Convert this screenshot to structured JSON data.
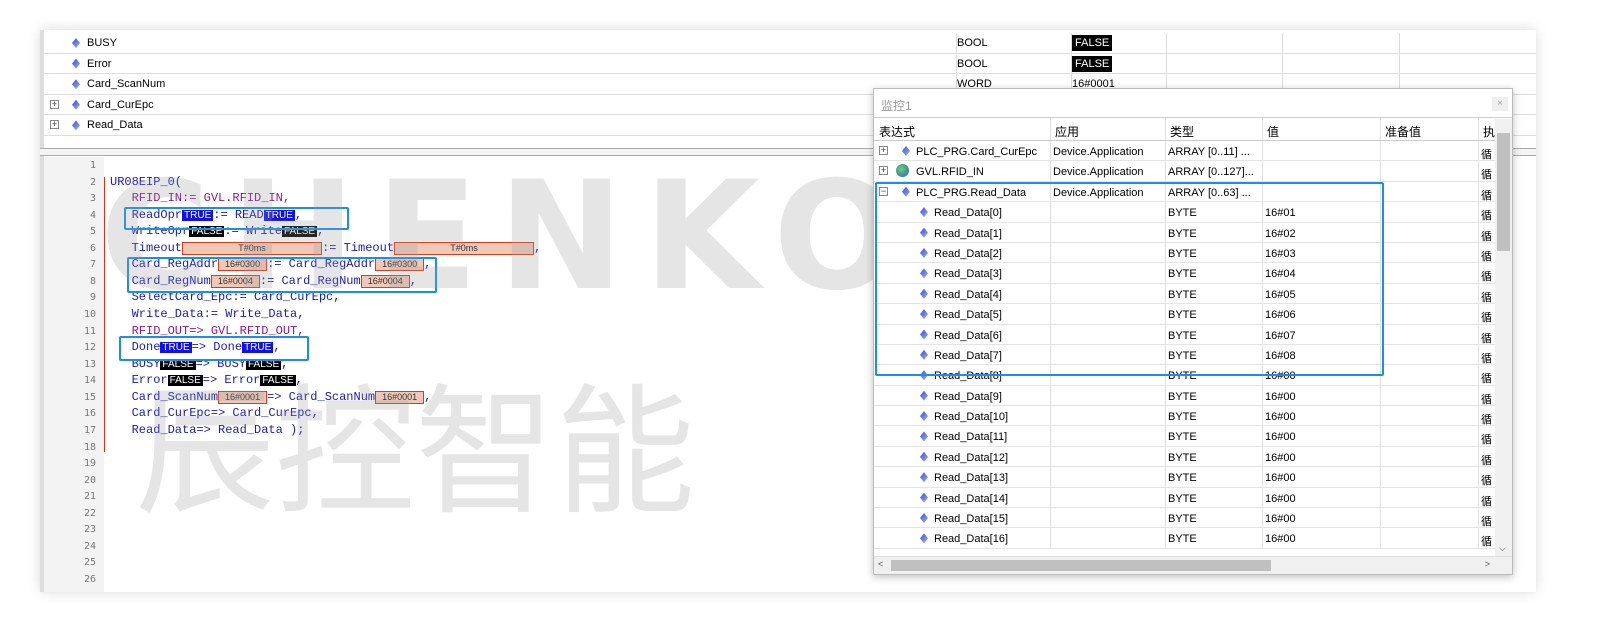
{
  "variables": [
    {
      "name": "BUSY",
      "type": "BOOL",
      "value": "FALSE",
      "expandable": false
    },
    {
      "name": "Error",
      "type": "BOOL",
      "value": "FALSE",
      "expandable": false
    },
    {
      "name": "Card_ScanNum",
      "type": "WORD",
      "value": "16#0001",
      "expandable": false
    },
    {
      "name": "Card_CurEpc",
      "type": "",
      "value": "",
      "expandable": true
    },
    {
      "name": "Read_Data",
      "type": "",
      "value": "",
      "expandable": true
    }
  ],
  "code": {
    "line_numbers": [
      "1",
      "2",
      "3",
      "4",
      "5",
      "6",
      "7",
      "8",
      "9",
      "10",
      "11",
      "12",
      "13",
      "14",
      "15",
      "16",
      "17",
      "18",
      "19",
      "20",
      "21",
      "22",
      "23",
      "24",
      "25",
      "26"
    ],
    "lines": [
      [],
      [
        {
          "t": "UR08EIP_0(",
          "c": "kw"
        }
      ],
      [
        {
          "t": "   RFID_IN:= GVL.RFID_IN,",
          "c": "purple"
        }
      ],
      [
        {
          "t": "   ReadOpr",
          "c": "kw"
        },
        {
          "t": "TRUE",
          "c": "tv"
        },
        {
          "t": ":= READ",
          "c": "kw"
        },
        {
          "t": "TRUE",
          "c": "tv"
        },
        {
          "t": ",",
          "c": "kw"
        }
      ],
      [
        {
          "t": "   WriteOpr",
          "c": "kw"
        },
        {
          "t": "FALSE",
          "c": "fv"
        },
        {
          "t": ":= Write",
          "c": "kw"
        },
        {
          "t": "FALSE",
          "c": "fv"
        },
        {
          "t": ",",
          "c": "kw"
        }
      ],
      [
        {
          "t": "   Timeout",
          "c": "kw"
        },
        {
          "t": "T#0ms",
          "c": "hv wide"
        },
        {
          "t": ":= Timeout",
          "c": "kw"
        },
        {
          "t": "T#0ms",
          "c": "hv wide"
        },
        {
          "t": ",",
          "c": "kw"
        }
      ],
      [
        {
          "t": "   Card_RegAddr",
          "c": "kw"
        },
        {
          "t": "16#0300",
          "c": "hv"
        },
        {
          "t": ":= Card_RegAddr",
          "c": "kw"
        },
        {
          "t": "16#0300",
          "c": "hv"
        },
        {
          "t": ",",
          "c": "kw"
        }
      ],
      [
        {
          "t": "   Card_RegNum",
          "c": "kw"
        },
        {
          "t": "16#0004",
          "c": "hv"
        },
        {
          "t": ":= Card_RegNum",
          "c": "kw"
        },
        {
          "t": "16#0004",
          "c": "hv"
        },
        {
          "t": ",",
          "c": "kw"
        }
      ],
      [
        {
          "t": "   SelectCard_Epc:= Card_CurEpc,",
          "c": "kw"
        }
      ],
      [
        {
          "t": "   Write_Data:= Write_Data,",
          "c": "kw"
        }
      ],
      [
        {
          "t": "   RFID_OUT=> GVL.RFID_OUT,",
          "c": "purple"
        }
      ],
      [
        {
          "t": "   Done",
          "c": "kw"
        },
        {
          "t": "TRUE",
          "c": "tv"
        },
        {
          "t": "=> Done",
          "c": "kw"
        },
        {
          "t": "TRUE",
          "c": "tv"
        },
        {
          "t": ",",
          "c": "kw"
        }
      ],
      [
        {
          "t": "   BUSY",
          "c": "kw"
        },
        {
          "t": "FALSE",
          "c": "fv"
        },
        {
          "t": "=> BUSY",
          "c": "kw"
        },
        {
          "t": "FALSE",
          "c": "fv"
        },
        {
          "t": ",",
          "c": "kw"
        }
      ],
      [
        {
          "t": "   Error",
          "c": "kw"
        },
        {
          "t": "FALSE",
          "c": "fv"
        },
        {
          "t": "=> Error",
          "c": "kw"
        },
        {
          "t": "FALSE",
          "c": "fv"
        },
        {
          "t": ",",
          "c": "kw"
        }
      ],
      [
        {
          "t": "   Card_ScanNum",
          "c": "kw"
        },
        {
          "t": "16#0001",
          "c": "hv"
        },
        {
          "t": "=> Card_ScanNum",
          "c": "kw"
        },
        {
          "t": "16#0001",
          "c": "hv"
        },
        {
          "t": ",",
          "c": "kw"
        }
      ],
      [
        {
          "t": "   Card_CurEpc=> Card_CurEpc,",
          "c": "kw"
        }
      ],
      [
        {
          "t": "   Read_Data=> Read_Data );",
          "c": "kw"
        }
      ]
    ]
  },
  "watch": {
    "title": "监控1",
    "close": "×",
    "headers": [
      "表达式",
      "应用",
      "类型",
      "值",
      "准备值",
      "执"
    ],
    "rows": [
      {
        "expr": "PLC_PRG.Card_CurEpc",
        "app": "Device.Application",
        "type": "ARRAY [0..11] ...",
        "value": "",
        "exec": "循",
        "level": 0,
        "toggle": "+",
        "icon": "var"
      },
      {
        "expr": "GVL.RFID_IN",
        "app": "Device.Application",
        "type": "ARRAY [0..127]...",
        "value": "",
        "exec": "循",
        "level": 0,
        "toggle": "+",
        "icon": "globe"
      },
      {
        "expr": "PLC_PRG.Read_Data",
        "app": "Device.Application",
        "type": "ARRAY [0..63] ...",
        "value": "",
        "exec": "循",
        "level": 0,
        "toggle": "−",
        "icon": "var"
      },
      {
        "expr": "Read_Data[0]",
        "app": "",
        "type": "BYTE",
        "value": "16#01",
        "exec": "循",
        "level": 1
      },
      {
        "expr": "Read_Data[1]",
        "app": "",
        "type": "BYTE",
        "value": "16#02",
        "exec": "循",
        "level": 1
      },
      {
        "expr": "Read_Data[2]",
        "app": "",
        "type": "BYTE",
        "value": "16#03",
        "exec": "循",
        "level": 1
      },
      {
        "expr": "Read_Data[3]",
        "app": "",
        "type": "BYTE",
        "value": "16#04",
        "exec": "循",
        "level": 1
      },
      {
        "expr": "Read_Data[4]",
        "app": "",
        "type": "BYTE",
        "value": "16#05",
        "exec": "循",
        "level": 1
      },
      {
        "expr": "Read_Data[5]",
        "app": "",
        "type": "BYTE",
        "value": "16#06",
        "exec": "循",
        "level": 1
      },
      {
        "expr": "Read_Data[6]",
        "app": "",
        "type": "BYTE",
        "value": "16#07",
        "exec": "循",
        "level": 1
      },
      {
        "expr": "Read_Data[7]",
        "app": "",
        "type": "BYTE",
        "value": "16#08",
        "exec": "循",
        "level": 1
      },
      {
        "expr": "Read_Data[8]",
        "app": "",
        "type": "BYTE",
        "value": "16#00",
        "exec": "循",
        "level": 1
      },
      {
        "expr": "Read_Data[9]",
        "app": "",
        "type": "BYTE",
        "value": "16#00",
        "exec": "循",
        "level": 1
      },
      {
        "expr": "Read_Data[10]",
        "app": "",
        "type": "BYTE",
        "value": "16#00",
        "exec": "循",
        "level": 1
      },
      {
        "expr": "Read_Data[11]",
        "app": "",
        "type": "BYTE",
        "value": "16#00",
        "exec": "循",
        "level": 1
      },
      {
        "expr": "Read_Data[12]",
        "app": "",
        "type": "BYTE",
        "value": "16#00",
        "exec": "循",
        "level": 1
      },
      {
        "expr": "Read_Data[13]",
        "app": "",
        "type": "BYTE",
        "value": "16#00",
        "exec": "循",
        "level": 1
      },
      {
        "expr": "Read_Data[14]",
        "app": "",
        "type": "BYTE",
        "value": "16#00",
        "exec": "循",
        "level": 1
      },
      {
        "expr": "Read_Data[15]",
        "app": "",
        "type": "BYTE",
        "value": "16#00",
        "exec": "循",
        "level": 1
      },
      {
        "expr": "Read_Data[16]",
        "app": "",
        "type": "BYTE",
        "value": "16#00",
        "exec": "循",
        "level": 1
      }
    ]
  },
  "watermark": {
    "latin": "CHENKONG",
    "chinese": "辰控智能",
    "mark": "®"
  },
  "colors": {
    "true_bg": "#1010e8",
    "false_bg": "#000000",
    "hex_bg": "#f0c8b8",
    "highlight": "#1a8ee8"
  }
}
